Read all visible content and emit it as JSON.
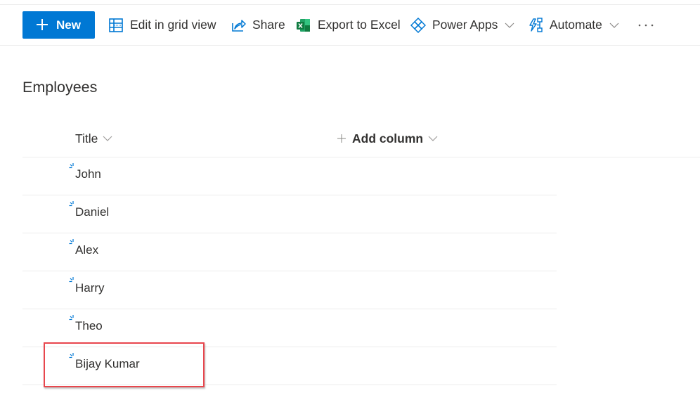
{
  "toolbar": {
    "new_label": "New",
    "items": [
      {
        "label": "Edit in grid view",
        "icon": "grid-icon"
      },
      {
        "label": "Share",
        "icon": "share-icon"
      },
      {
        "label": "Export to Excel",
        "icon": "excel-icon"
      },
      {
        "label": "Power Apps",
        "icon": "power-apps-icon",
        "has_dropdown": true
      },
      {
        "label": "Automate",
        "icon": "automate-icon",
        "has_dropdown": true
      }
    ],
    "more_icon": "ellipsis-icon"
  },
  "list": {
    "title": "Employees",
    "columns": [
      {
        "label": "Title",
        "has_dropdown": true
      },
      {
        "label": "Add column",
        "has_dropdown": true,
        "prefix_icon": "plus-icon"
      }
    ],
    "rows": [
      {
        "title": "John",
        "is_new": true
      },
      {
        "title": "Daniel",
        "is_new": true
      },
      {
        "title": "Alex",
        "is_new": true
      },
      {
        "title": "Harry",
        "is_new": true
      },
      {
        "title": "Theo",
        "is_new": true
      },
      {
        "title": "Bijay Kumar",
        "is_new": true,
        "highlighted": true
      }
    ]
  },
  "colors": {
    "accent": "#0078d4",
    "highlight_border": "#e8464d",
    "text": "#323130",
    "divider": "#ededed"
  }
}
